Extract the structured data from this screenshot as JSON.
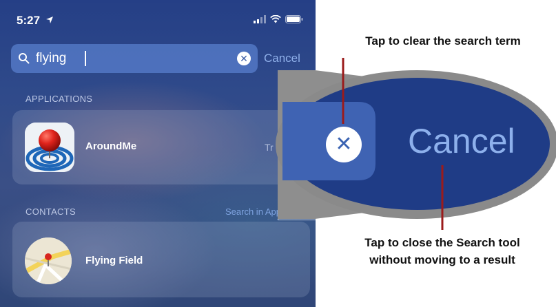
{
  "status_bar": {
    "time": "5:27"
  },
  "search": {
    "query": "flying",
    "cancel_label": "Cancel"
  },
  "sections": {
    "applications": "APPLICATIONS",
    "contacts": "CONTACTS",
    "contacts_action": "Search in App"
  },
  "results": {
    "app_name": "AroundMe",
    "app_trailing_text": "Tr",
    "contact_name": "Flying Field"
  },
  "zoom": {
    "cancel_label": "Cancel"
  },
  "annotations": {
    "clear": "Tap to clear the search term",
    "close_line1": "Tap to close the Search tool",
    "close_line2": "without moving to a result"
  },
  "colors": {
    "accent_line": "#9b1b1b",
    "callout_border": "#7a7a7a",
    "lens_blue": "#1f3c86"
  },
  "icons": [
    "location-arrow-icon",
    "signal-icon",
    "wifi-icon",
    "battery-icon",
    "search-icon",
    "clear-icon",
    "aroundme-app-icon",
    "contact-map-icon"
  ]
}
